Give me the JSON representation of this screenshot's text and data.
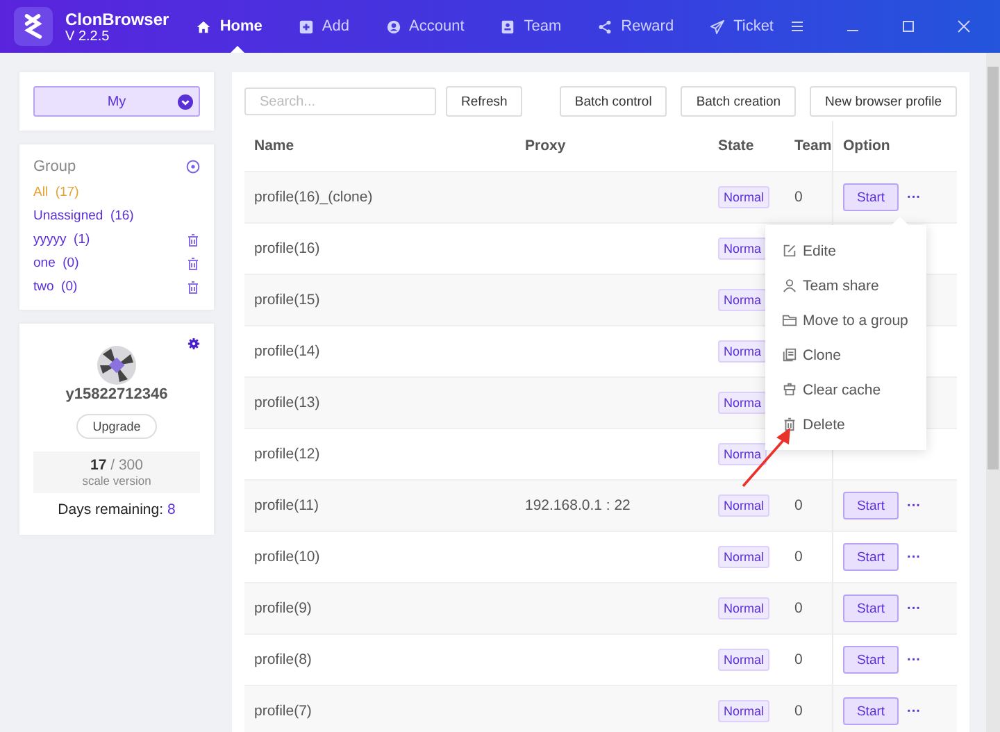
{
  "app": {
    "name": "ClonBrowser",
    "version": "V 2.2.5"
  },
  "nav": [
    {
      "label": "Home",
      "kind": "home",
      "selected": true
    },
    {
      "label": "Add",
      "kind": "add",
      "selected": false
    },
    {
      "label": "Account",
      "kind": "account",
      "selected": false
    },
    {
      "label": "Team",
      "kind": "team",
      "selected": false
    },
    {
      "label": "Reward",
      "kind": "share",
      "selected": false
    },
    {
      "label": "Ticket",
      "kind": "send",
      "selected": false
    }
  ],
  "scope": {
    "value": "My"
  },
  "groups": {
    "title": "Group",
    "items": [
      {
        "label": "All",
        "count": "(17)",
        "selected": true,
        "deletable": false
      },
      {
        "label": "Unassigned",
        "count": "(16)",
        "selected": false,
        "deletable": false
      },
      {
        "label": "yyyyy",
        "count": "(1)",
        "selected": false,
        "deletable": true
      },
      {
        "label": "one",
        "count": "(0)",
        "selected": false,
        "deletable": true
      },
      {
        "label": "two",
        "count": "(0)",
        "selected": false,
        "deletable": true
      }
    ]
  },
  "account": {
    "username": "y15822712346",
    "upgrade": "Upgrade",
    "used": "17",
    "separator": "/",
    "total": "300",
    "plan": "scale version",
    "days_label": "Days remaining:",
    "days": "8"
  },
  "toolbar": {
    "search": {
      "placeholder": "Search..."
    },
    "buttons": [
      "Refresh",
      "Batch control",
      "Batch creation",
      "New browser profile"
    ]
  },
  "table": {
    "columns": [
      "Name",
      "Proxy",
      "State",
      "Team",
      "Option"
    ],
    "rows": [
      {
        "name": "profile(16)_(clone)",
        "proxy": "",
        "state": "Normal",
        "team": "0",
        "action": "Start",
        "more": "···"
      },
      {
        "name": "profile(16)",
        "proxy": "",
        "state": "Norma"
      },
      {
        "name": "profile(15)",
        "proxy": "",
        "state": "Norma"
      },
      {
        "name": "profile(14)",
        "proxy": "",
        "state": "Norma"
      },
      {
        "name": "profile(13)",
        "proxy": "",
        "state": "Norma"
      },
      {
        "name": "profile(12)",
        "proxy": "",
        "state": "Norma"
      },
      {
        "name": "profile(11)",
        "proxy": "192.168.0.1 : 22",
        "state": "Normal",
        "team": "0",
        "action": "Start",
        "more": "···"
      },
      {
        "name": "profile(10)",
        "proxy": "",
        "state": "Normal",
        "team": "0",
        "action": "Start",
        "more": "···"
      },
      {
        "name": "profile(9)",
        "proxy": "",
        "state": "Normal",
        "team": "0",
        "action": "Start",
        "more": "···"
      },
      {
        "name": "profile(8)",
        "proxy": "",
        "state": "Normal",
        "team": "0",
        "action": "Start",
        "more": "···"
      },
      {
        "name": "profile(7)",
        "proxy": "",
        "state": "Normal",
        "team": "0",
        "action": "Start",
        "more": "···"
      }
    ]
  },
  "menu": {
    "items": [
      {
        "label": "Edite",
        "kind": "edit"
      },
      {
        "label": "Team share",
        "kind": "user"
      },
      {
        "label": "Move to a group",
        "kind": "folder"
      },
      {
        "label": "Clone",
        "kind": "copy"
      },
      {
        "label": "Clear cache",
        "kind": "cache"
      },
      {
        "label": "Delete",
        "kind": "trash"
      }
    ]
  },
  "annotation": {
    "kind": "arrow"
  }
}
